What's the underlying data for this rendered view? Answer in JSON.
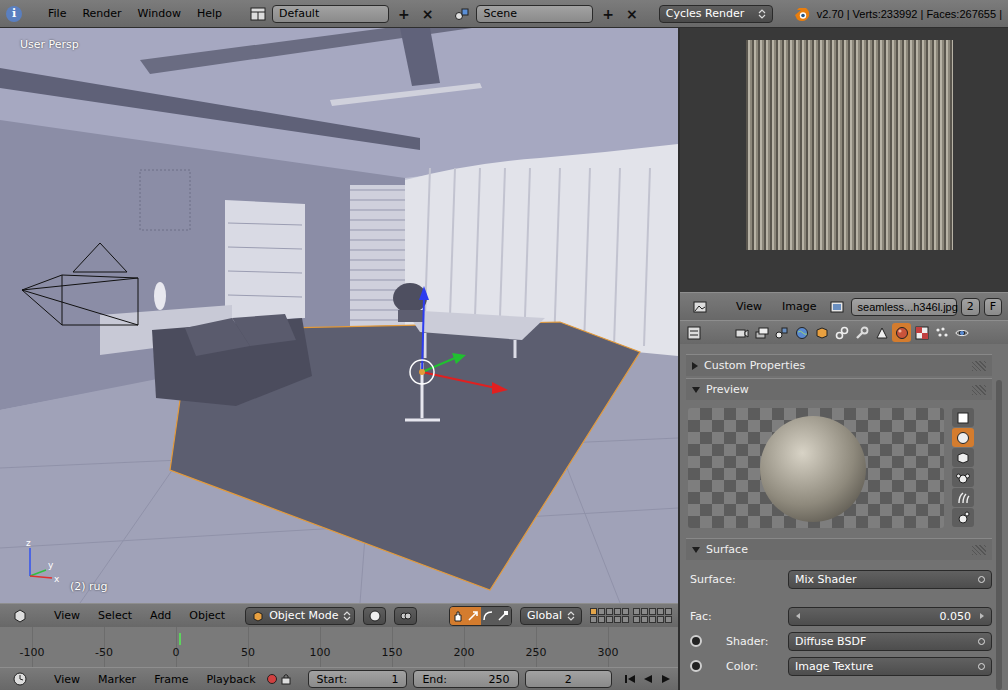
{
  "top_bar": {
    "info_icon": "i",
    "menus": [
      "File",
      "Render",
      "Window",
      "Help"
    ],
    "screen_layout": "Default",
    "scene": "Scene",
    "add": "+",
    "remove": "×",
    "render_engine": "Cycles Render",
    "stats": "v2.70 | Verts:233992 | Faces:267655 |"
  },
  "viewport": {
    "view_name": "User Persp",
    "object_label": "(2) rug",
    "axes": [
      "z",
      "y",
      "x"
    ]
  },
  "viewport_header": {
    "menus": [
      "View",
      "Select",
      "Add",
      "Object"
    ],
    "mode": "Object Mode",
    "orientation": "Global",
    "tools": [
      {
        "kind": "manipulator",
        "selected": true
      },
      {
        "kind": "translate",
        "selected": true
      },
      {
        "kind": "rotate",
        "selected": false
      },
      {
        "kind": "scale",
        "selected": false
      }
    ],
    "layers": [
      {
        "active": true
      },
      {
        "active": false
      },
      {
        "active": false
      },
      {
        "active": false
      },
      {
        "active": false
      },
      {
        "active": false
      },
      {
        "active": false
      },
      {
        "active": false
      },
      {
        "active": false
      },
      {
        "active": false
      },
      {
        "active": false
      },
      {
        "active": false
      },
      {
        "active": false
      },
      {
        "active": false
      },
      {
        "active": false
      },
      {
        "active": false
      },
      {
        "active": false
      },
      {
        "active": false
      },
      {
        "active": false
      },
      {
        "active": false
      }
    ]
  },
  "timeline": {
    "ticks": [
      "-100",
      "-50",
      "0",
      "50",
      "100",
      "150",
      "200",
      "250",
      "300"
    ]
  },
  "timeline_header": {
    "menus": [
      "View",
      "Marker",
      "Frame",
      "Playback"
    ],
    "start_label": "Start:",
    "start": "1",
    "end_label": "End:",
    "end": "250",
    "current_frame": "2"
  },
  "image_editor": {
    "menus": [
      "View",
      "Image"
    ],
    "image_name": "seamless...h346l.jpg",
    "users": "2",
    "fake_user": "F"
  },
  "properties": {
    "tabs": [
      {
        "kind": "render",
        "selected": false
      },
      {
        "kind": "layers",
        "selected": false
      },
      {
        "kind": "scene",
        "selected": false
      },
      {
        "kind": "world",
        "selected": false
      },
      {
        "kind": "object",
        "selected": false
      },
      {
        "kind": "constraints",
        "selected": false
      },
      {
        "kind": "modifiers",
        "selected": false
      },
      {
        "kind": "data",
        "selected": false
      },
      {
        "kind": "material",
        "selected": true
      },
      {
        "kind": "texture",
        "selected": false
      },
      {
        "kind": "particles",
        "selected": false
      },
      {
        "kind": "physics",
        "selected": false
      }
    ],
    "custom_properties": {
      "title": "Custom Properties",
      "expanded": false
    },
    "preview": {
      "title": "Preview",
      "expanded": true,
      "shapes": [
        {
          "kind": "flat",
          "selected": false
        },
        {
          "kind": "sphere",
          "selected": true
        },
        {
          "kind": "cube",
          "selected": false
        },
        {
          "kind": "monkey",
          "selected": false
        },
        {
          "kind": "hair",
          "selected": false
        },
        {
          "kind": "sky",
          "selected": false
        }
      ]
    },
    "surface": {
      "title": "Surface",
      "expanded": true,
      "rows": [
        {
          "label": "Surface:",
          "value": "Mix Shader",
          "kind": "menu",
          "socket": false
        },
        {
          "label": "Fac:",
          "value": "0.050",
          "kind": "number",
          "socket": false
        },
        {
          "label": "Shader:",
          "value": "Diffuse BSDF",
          "kind": "menu",
          "socket": true
        },
        {
          "label": "Color:",
          "value": "Image Texture",
          "kind": "menu",
          "socket": true
        }
      ]
    }
  }
}
